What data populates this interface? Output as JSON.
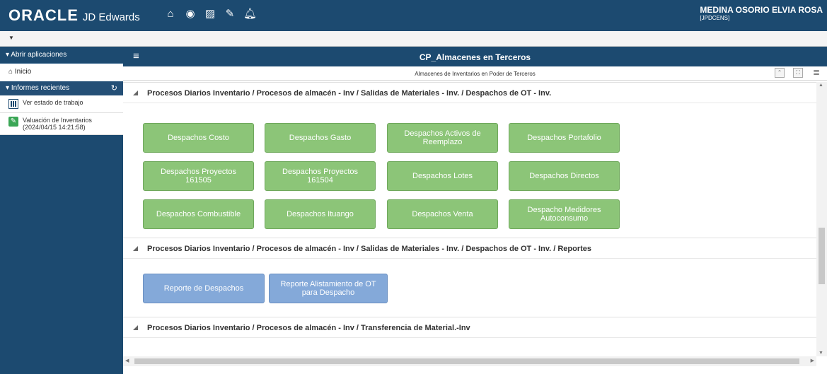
{
  "header": {
    "brand": "ORACLE",
    "product": "JD Edwards",
    "user_name": "MEDINA OSORIO ELVIA ROSA",
    "user_env": "[JPDCENS]"
  },
  "nav_icons": [
    "home-icon",
    "recent-icon",
    "chart-icon",
    "edit-icon",
    "bell-icon"
  ],
  "sidebar": {
    "open_apps_label": "Abrir aplicaciones",
    "home_label": "Inicio",
    "recent_reports_label": "Informes recientes",
    "items": [
      {
        "label": "Ver estado de trabajo",
        "icon": "chart-icon"
      },
      {
        "label": "Valuación de Inventarios",
        "sub": "(2024/04/15 14:21:58)",
        "icon": "edit-icon"
      }
    ]
  },
  "main": {
    "title": "CP_Almacenes en Terceros",
    "description": "Almacenes de Inventarios en Poder de Terceros",
    "sections": [
      {
        "title": "Procesos Diarios Inventario / Procesos de almacén - Inv / Salidas de Materiales - Inv. / Despachos de OT - Inv.",
        "buttons": [
          "Despachos Costo",
          "Despachos Gasto",
          "Despachos Activos de Reemplazo",
          "Despachos Portafolio",
          "Despachos Proyectos 161505",
          "Despachos Proyectos 161504",
          "Despachos Lotes",
          "Despachos Directos",
          "Despachos Combustible",
          "Despachos Ituango",
          "Despachos Venta",
          "Despacho Medidores Autoconsumo"
        ]
      },
      {
        "title": "Procesos Diarios Inventario / Procesos de almacén - Inv / Salidas de Materiales - Inv. / Despachos de OT - Inv. / Reportes",
        "buttons": [
          "Reporte de Despachos",
          "Reporte Alistamiento de OT para Despacho"
        ]
      },
      {
        "title": "Procesos Diarios Inventario / Procesos de almacén - Inv / Transferencia de Material.-Inv",
        "buttons": []
      }
    ]
  },
  "colors": {
    "header_bg": "#1c4a70",
    "green_button": "#8cc578",
    "blue_button": "#84a9d9"
  }
}
